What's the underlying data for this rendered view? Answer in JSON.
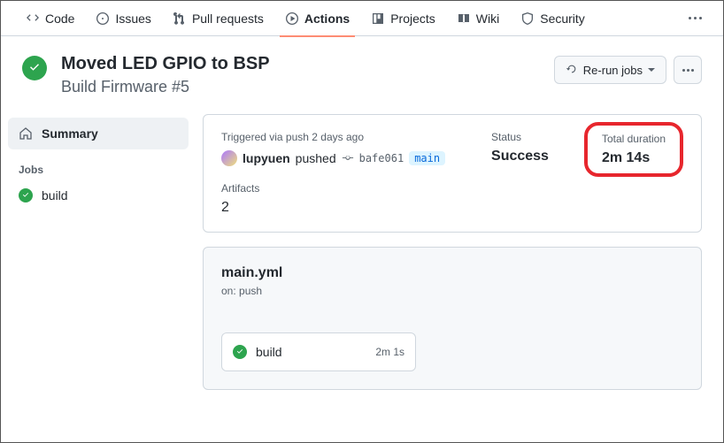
{
  "tabs": {
    "code": "Code",
    "issues": "Issues",
    "prs": "Pull requests",
    "actions": "Actions",
    "projects": "Projects",
    "wiki": "Wiki",
    "security": "Security"
  },
  "run": {
    "title": "Moved LED GPIO to BSP",
    "workflow_line": "Build Firmware #5"
  },
  "header_buttons": {
    "rerun": "Re-run jobs"
  },
  "sidebar": {
    "summary": "Summary",
    "jobs_heading": "Jobs",
    "job_build": "build"
  },
  "summary": {
    "trigger_label": "Triggered via push 2 days ago",
    "actor": "lupyuen",
    "verb": "pushed",
    "sha": "bafe061",
    "branch": "main",
    "status_label": "Status",
    "status_value": "Success",
    "duration_label": "Total duration",
    "duration_value": "2m 14s",
    "artifacts_label": "Artifacts",
    "artifacts_value": "2"
  },
  "workflow": {
    "file": "main.yml",
    "on": "on: push",
    "job_name": "build",
    "job_duration": "2m 1s"
  }
}
